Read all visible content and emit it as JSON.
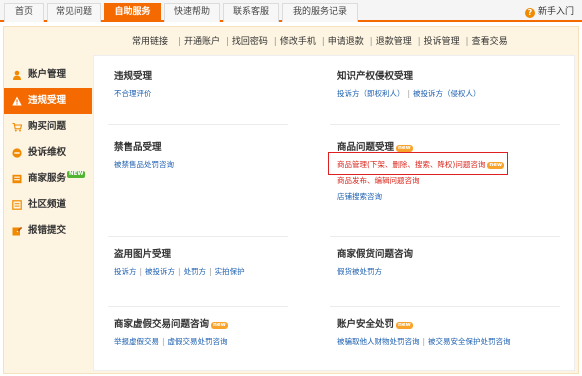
{
  "topnav": {
    "tabs": [
      {
        "label": "首页"
      },
      {
        "label": "常见问题"
      },
      {
        "label": "自助服务"
      },
      {
        "label": "快速帮助"
      },
      {
        "label": "联系客服"
      },
      {
        "label": "我的服务记录"
      }
    ],
    "active_tab": "自助服务",
    "guide_label": "新手入门"
  },
  "quick_links": {
    "lead": "常用链接",
    "items": [
      "开通账户",
      "找回密码",
      "修改手机",
      "申请退款",
      "退款管理",
      "投诉管理",
      "查看交易"
    ]
  },
  "sidebar": {
    "items": [
      {
        "label": "账户管理",
        "icon": "person-icon"
      },
      {
        "label": "违规受理",
        "icon": "warning-icon",
        "active": true
      },
      {
        "label": "购买问题",
        "icon": "cart-icon"
      },
      {
        "label": "投诉维权",
        "icon": "complaint-icon"
      },
      {
        "label": "商家服务",
        "icon": "shop-icon",
        "badge": "NEW"
      },
      {
        "label": "社区频道",
        "icon": "community-icon"
      },
      {
        "label": "报错提交",
        "icon": "report-icon"
      }
    ]
  },
  "sections": {
    "violation": {
      "title": "违规受理",
      "links": [
        "不合理评价"
      ]
    },
    "ip": {
      "title": "知识产权侵权受理",
      "links": [
        "投诉方（即权利人）",
        "被投诉方（侵权人）"
      ]
    },
    "prohibited": {
      "title": "禁售品受理",
      "links": [
        "被禁售品处罚咨询"
      ]
    },
    "product": {
      "title": "商品问题受理",
      "badge": "new",
      "links": [
        "商品管理(下架、删除、搜索、降权)问题咨询",
        "商品发布、编辑问题咨询",
        "店铺搜索咨询"
      ],
      "link_badge": "new"
    },
    "image": {
      "title": "盗用图片受理",
      "links": [
        "投诉方",
        "被投诉方",
        "处罚方",
        "实拍保护"
      ]
    },
    "fake_shipping": {
      "title": "商家假货问题咨询",
      "links": [
        "假货被处罚方"
      ]
    },
    "virtual": {
      "title": "商家虚假交易问题咨询",
      "badge": "new",
      "links": [
        "举报虚假交易",
        "虚假交易处罚咨询"
      ]
    },
    "account_security": {
      "title": "账户安全处罚",
      "badge": "new",
      "links": [
        "被骗取他人财物处罚咨询",
        "被交易安全保护处罚咨询"
      ]
    }
  },
  "colors": {
    "accent": "#f56a00",
    "link": "#1c5fb0",
    "alert": "#d9261c",
    "highlight_border": "#e02020",
    "frame_bg": "#fdf4e1"
  }
}
